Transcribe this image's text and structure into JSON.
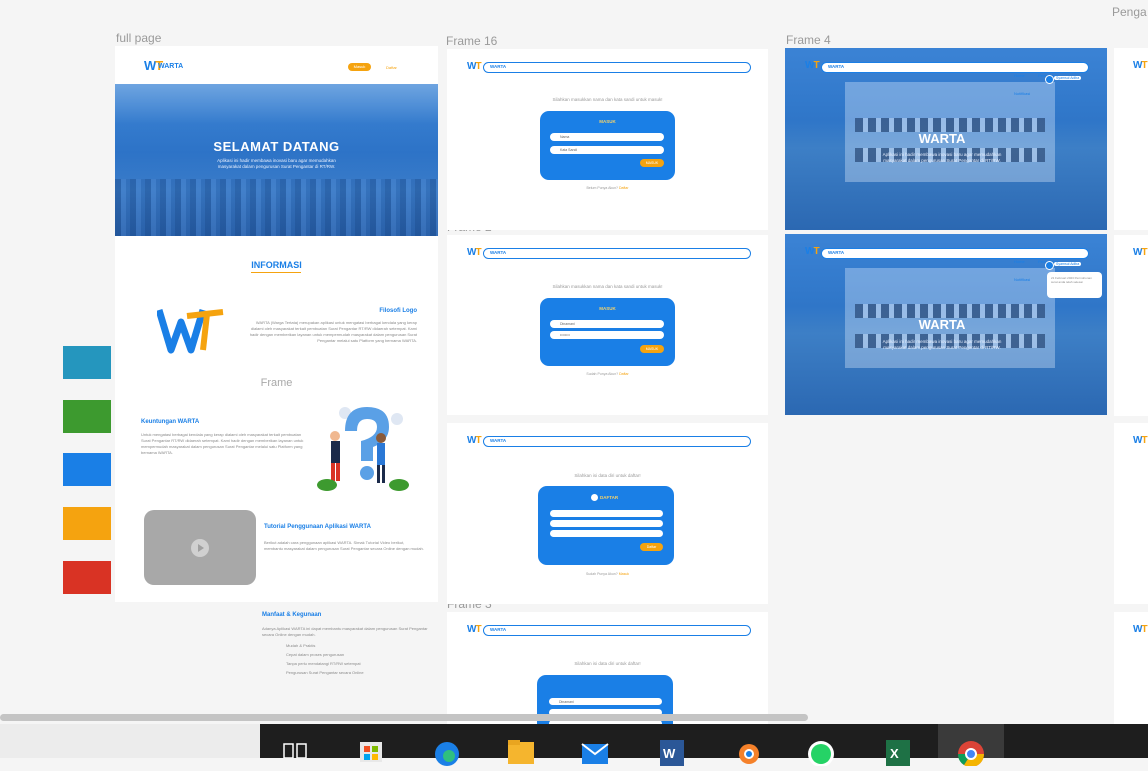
{
  "canvas": {
    "labels": {
      "full_page": "full page",
      "frame16": "Frame 16",
      "frame4": "Frame 4",
      "frame2": "Frame 2",
      "frame3": "Frame 3",
      "pengaduan_partial": "Penga"
    }
  },
  "full_page": {
    "logo_text": "WARTA",
    "nav_masuk": "Masuk",
    "nav_daftar": "Daftar",
    "hero_title": "SELAMAT DATANG",
    "hero_sub_line1": "Aplikasi ini hadir membawa inovasi baru agar memudahkan",
    "hero_sub_line2": "masyarakat dalam pengurusan Surat Pengantar di RT/RW.",
    "informasi_title": "INFORMASI",
    "filosofi_title": "Filosofi Logo",
    "filosofi_text": "WARTA (Warga Tertata) merupakan aplikasi untuk mengatasi berbagai kendala yang kerap dialami oleh masyarakat terkait pembuatan Surat Pengantar RT/RW didaerah setempat. Kami hadir dengan memberikan layanan untuk mempermudah masyarakat dalam pengurusan Surat Pengantar melalui satu Platform yang bernama WARTA.",
    "frame_label": "Frame",
    "keuntungan_title": "Keuntungan WARTA",
    "keuntungan_text": "Untuk mengatasi berbagai kendala yang kerap dialami oleh masyarakat terkait pembuatan Surat Pengantar RT/RW didaerah setempat. Kami hadir dengan memberikan layanan untuk mempermudah masyarakat dalam pengurusan Surat Pengantar melalui satu Platform yang bernama WARTA.",
    "tutorial_title": "Tutorial Penggunaan Aplikasi WARTA",
    "tutorial_text": "Berikut adalah cara penggunaan aplikasi WARTA. Simak Tutorial Video berikut, membantu masyarakat dalam pengurusan Surat Pengantar secara Online dengan mudah.",
    "manfaat_title": "Manfaat & Kegunaan",
    "manfaat_text": "Adanya Aplikasi WARTA ini dapat membantu masyarakat dalam pengurusan Surat Pengantar secara Online dengan mudah.",
    "manfaat_items": [
      "Mudah & Praktis",
      "Cepat dalam proses pengurusan",
      "Tanpa perlu mendatangi RT/RW setempat",
      "Pengurusan Surat Pengantar secara Online"
    ]
  },
  "frame16": {
    "nav_label": "WARTA",
    "prompt": "Silahkan masukkan nama dan kata sandi untuk masuk!",
    "card_title": "MASUK",
    "field1": "Nama",
    "field2": "Kata Sandi",
    "button": "MASUK",
    "footer": "Belum Punya Akun?",
    "footer_link": "Daftar"
  },
  "frame2": {
    "nav_label": "WARTA",
    "prompt": "Silahkan masukkan nama dan kata sandi untuk masuk!",
    "card_title": "MASUK",
    "field1": "Dinamani",
    "field2": "••••••••",
    "button": "MASUK",
    "footer": "Sudah Punya Akun?",
    "footer_link": "Daftar"
  },
  "frame_daftar": {
    "nav_label": "WARTA",
    "prompt": "Silahkan isi data diri untuk daftar!",
    "card_title": "DAFTAR",
    "button": "Daftar",
    "footer": "Sudah Punya Akun?",
    "footer_link": "Masuk"
  },
  "frame3": {
    "nav_label": "WARTA",
    "prompt": "Silahkan isi data diri untuk daftar!",
    "field1": "Dinamani"
  },
  "frame4": {
    "nav_label": "WARTA",
    "nav_items": [
      "Home",
      "Pengaduan",
      "Notifikasi"
    ],
    "user": "Syamsul Adiba",
    "title": "WARTA",
    "sub_line1": "Aplikasi ini hadir membawa inovasi baru agar memudahkan",
    "sub_line2": "masyarakat dalam pengurusan Surat Pengantar di RT/RW."
  },
  "frame5": {
    "nav_label": "WARTA",
    "nav_items": [
      "Home",
      "Pengaduan",
      "Notifikasi"
    ],
    "user": "Syamsul Adiba",
    "popup_text": "21 Februari 2023 Permohonan surat anda telah selesai",
    "title": "WARTA",
    "sub_line1": "Aplikasi ini hadir membawa inovasi baru agar memudahkan",
    "sub_line2": "masyarakat dalam pengurusan Surat Pengantar di RT/RW."
  },
  "swatches": [
    "#2596be",
    "#3d9a2f",
    "#1a7fe6",
    "#f5a30f",
    "#d93324"
  ],
  "taskbar": {
    "icons": [
      "task-view-icon",
      "store-icon",
      "edge-icon",
      "file-explorer-icon",
      "mail-icon",
      "word-icon",
      "blender-icon",
      "whatsapp-icon",
      "excel-icon",
      "chrome-icon"
    ]
  }
}
